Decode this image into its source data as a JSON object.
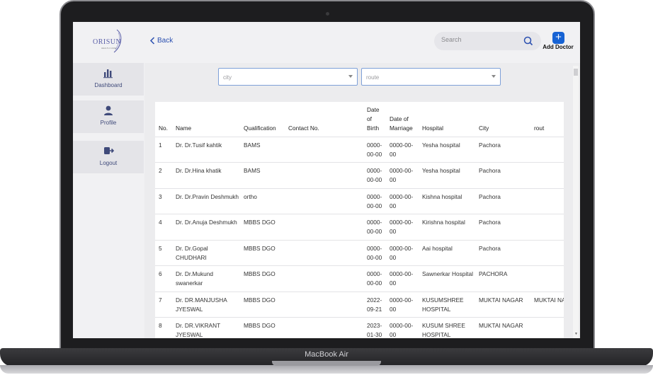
{
  "device": {
    "label": "MacBook Air"
  },
  "header": {
    "logo_text": "ORISUN",
    "logo_sub": "HEALTH CARE",
    "back_label": "Back",
    "search_placeholder": "Search",
    "add_label": "Add Doctor"
  },
  "sidebar": {
    "items": [
      {
        "label": "Dashboard",
        "icon": "bar-chart-icon"
      },
      {
        "label": "Profile",
        "icon": "user-icon"
      },
      {
        "label": "Logout",
        "icon": "logout-icon"
      }
    ]
  },
  "filters": {
    "city": "city",
    "route": "route"
  },
  "table": {
    "headers": [
      "No.",
      "Name",
      "Qualification",
      "Contact No.",
      "Date of Birth",
      "Date of Marriage",
      "Hospital",
      "City",
      "rout"
    ],
    "rows": [
      [
        "1",
        "Dr. Dr.Tusif kahtik",
        "BAMS",
        "",
        "0000-00-00",
        "0000-00-00",
        "Yesha hospital",
        "Pachora",
        ""
      ],
      [
        "2",
        "Dr. Dr.Hina khatik",
        "BAMS",
        "",
        "0000-00-00",
        "0000-00-00",
        "Yesha hospital",
        "Pachora",
        ""
      ],
      [
        "3",
        "Dr. Dr.Pravin Deshmukh",
        "ortho",
        "",
        "0000-00-00",
        "0000-00-00",
        "Kishna hospital",
        "Pachora",
        ""
      ],
      [
        "4",
        "Dr. Dr.Anuja Deshmukh",
        "MBBS DGO",
        "",
        "0000-00-00",
        "0000-00-00",
        "Kirishna hospital",
        "Pachora",
        ""
      ],
      [
        "5",
        "Dr. Dr.Gopal CHUDHARI",
        "MBBS DGO",
        "",
        "0000-00-00",
        "0000-00-00",
        "Aai hospital",
        "Pachora",
        ""
      ],
      [
        "6",
        "Dr. Dr.Mukund swanerkar",
        "MBBS DGO",
        "",
        "0000-00-00",
        "0000-00-00",
        "Sawnerkar Hospital",
        "PACHORA",
        ""
      ],
      [
        "7",
        "Dr. DR.MANJUSHA JYESWAL",
        "MBBS DGO",
        "",
        "2022-09-21",
        "0000-00-00",
        "KUSUMSHREE HOSPITAL",
        "MUKTAI NAGAR",
        "MUKTAI NAGAR"
      ],
      [
        "8",
        "Dr. DR.VIKRANT JYESWAL",
        "MBBS DGO",
        "",
        "2023-01-30",
        "0000-00-00",
        "KUSUM SHREE HOSPITAL",
        "MUKTAI NAGAR",
        ""
      ]
    ]
  },
  "colors": {
    "accent": "#1763d4",
    "sidebar_active": "#e4e4e8",
    "nav_text": "#3f4a7a"
  }
}
